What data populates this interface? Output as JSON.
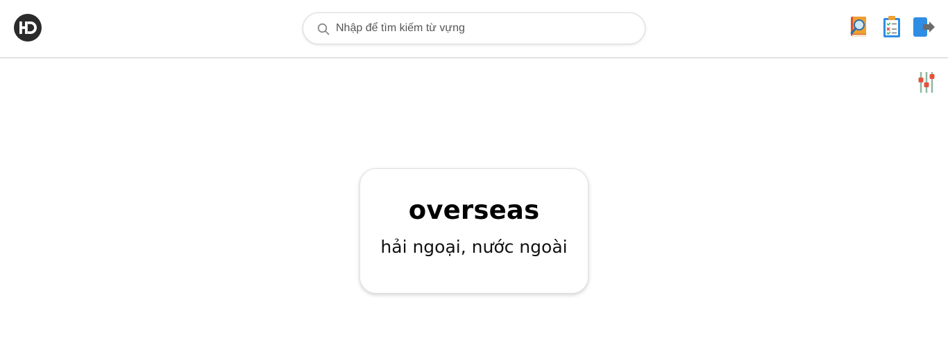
{
  "header": {
    "logo_text": "HD",
    "search": {
      "placeholder": "Nhập để tìm kiếm từ vựng",
      "value": ""
    },
    "icons": [
      "dictionary-search-icon",
      "quiz-clipboard-icon",
      "logout-icon"
    ]
  },
  "toolbar": {
    "filter_icon": "settings-sliders-icon"
  },
  "card": {
    "word": "overseas",
    "meaning": "hải ngoại, nước ngoài"
  },
  "colors": {
    "logo_bg": "#2b2b2b",
    "border": "#c8c8c8",
    "accent_blue": "#2f8de4",
    "accent_red": "#e5533d"
  }
}
